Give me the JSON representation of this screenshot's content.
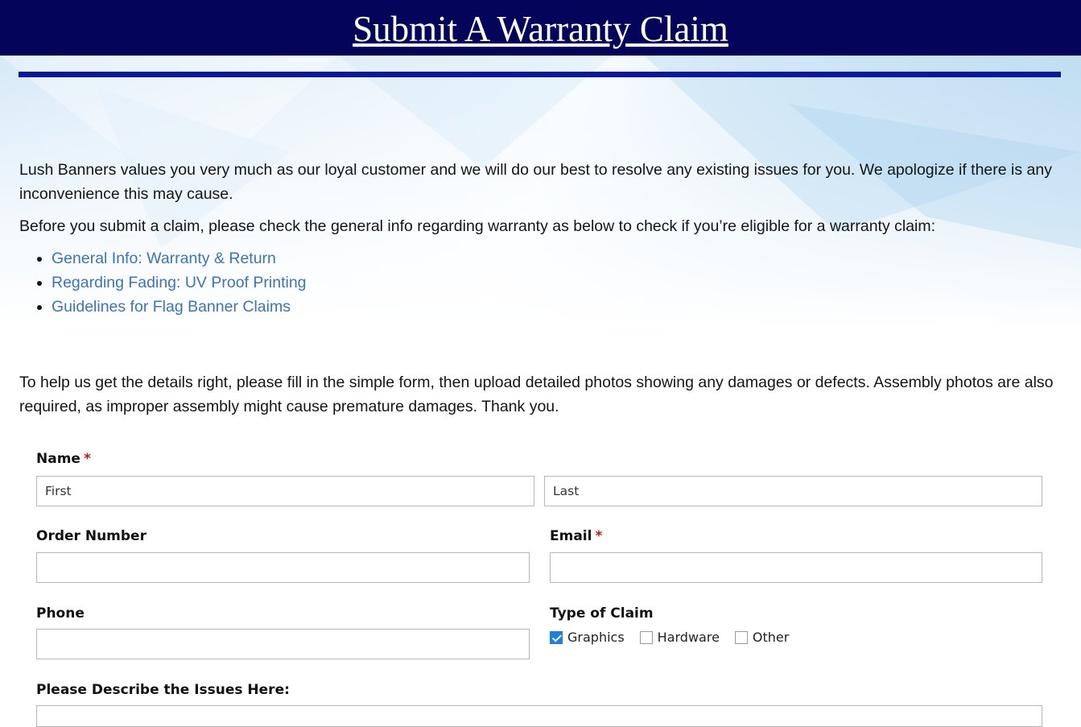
{
  "header": {
    "title": "Submit A Warranty Claim"
  },
  "intro": {
    "paragraph1": "Lush Banners values you very much as our loyal customer and we will do our best to resolve any existing issues for you. We apologize if there is any inconvenience this may cause.",
    "paragraph2": "Before you submit a claim, please check the general info regarding warranty as below to check if you’re eligible for a warranty claim:",
    "links": [
      "General Info: Warranty & Return",
      "Regarding Fading: UV Proof Printing",
      "Guidelines for Flag Banner Claims"
    ],
    "paragraph3": "To help us get the details right, please fill in the simple form, then upload detailed photos showing any damages or defects. Assembly photos are also required, as improper assembly might cause premature damages. Thank you."
  },
  "form": {
    "name_label": "Name",
    "first_placeholder": "First",
    "last_placeholder": "Last",
    "order_label": "Order Number",
    "email_label": "Email",
    "phone_label": "Phone",
    "claim_type_label": "Type of Claim",
    "claim_options": [
      {
        "label": "Graphics",
        "checked": true
      },
      {
        "label": "Hardware",
        "checked": false
      },
      {
        "label": "Other",
        "checked": false
      }
    ],
    "describe_label": "Please Describe the Issues Here:",
    "required_mark": "*"
  },
  "colors": {
    "header_bg": "#03045a",
    "rule": "#0a18a0",
    "link": "#3a75b5",
    "required": "#c0171d",
    "checkbox_checked": "#1f7fe0"
  }
}
